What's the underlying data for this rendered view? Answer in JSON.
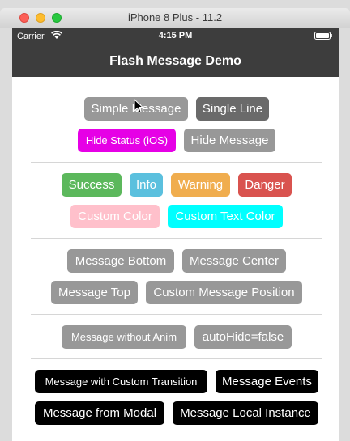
{
  "simulator": {
    "title": "iPhone 8 Plus - 11.2"
  },
  "status_bar": {
    "carrier": "Carrier",
    "time": "4:15 PM"
  },
  "nav": {
    "title": "Flash Message Demo"
  },
  "buttons": {
    "simple_message": "Simple Message",
    "single_line": "Single Line",
    "hide_status": "Hide Status (iOS)",
    "hide_message": "Hide Message",
    "success": "Success",
    "info": "Info",
    "warning": "Warning",
    "danger": "Danger",
    "custom_color": "Custom Color",
    "custom_text_color": "Custom Text Color",
    "message_bottom": "Message Bottom",
    "message_center": "Message Center",
    "message_top": "Message Top",
    "custom_message_position": "Custom Message Position",
    "message_without_anim": "Message without Anim",
    "autohide_false": "autoHide=false",
    "custom_transition": "Message with Custom Transition",
    "message_events": "Message Events",
    "message_from_modal": "Message from Modal",
    "message_local_instance": "Message Local Instance"
  },
  "colors": {
    "gray": "#989898",
    "magenta": "#e600e6",
    "success": "#5cb85c",
    "info": "#5bc0de",
    "warning": "#f0ad4e",
    "danger": "#d9534f",
    "pink": "#ffc0cb",
    "cyan": "#00ffff",
    "black": "#000000"
  }
}
